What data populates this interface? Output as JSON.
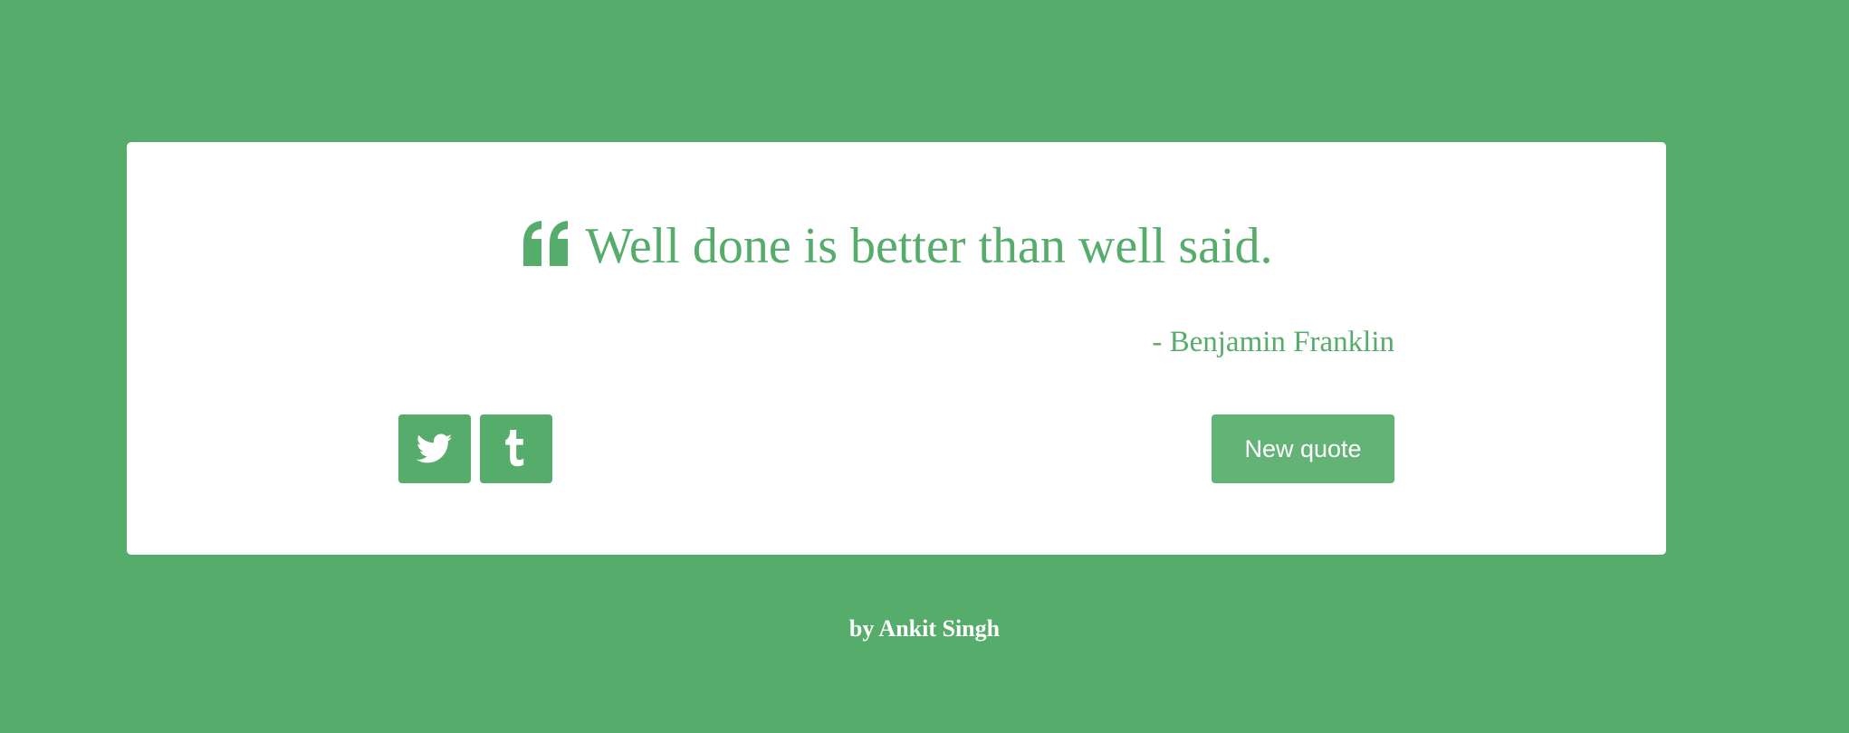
{
  "colors": {
    "background": "#56ac6a",
    "card": "#ffffff",
    "accent": "#56ac6a",
    "new_quote_button": "#63b377",
    "button_text": "#ffffff"
  },
  "quote": {
    "icon": "quote-left-icon",
    "text": "Well done is better than well said.",
    "author": "- Benjamin Franklin"
  },
  "actions": {
    "share_twitter_icon": "twitter-icon",
    "share_tumblr_icon": "tumblr-icon",
    "new_quote_label": "New quote"
  },
  "footer": {
    "credit": "by Ankit Singh"
  }
}
